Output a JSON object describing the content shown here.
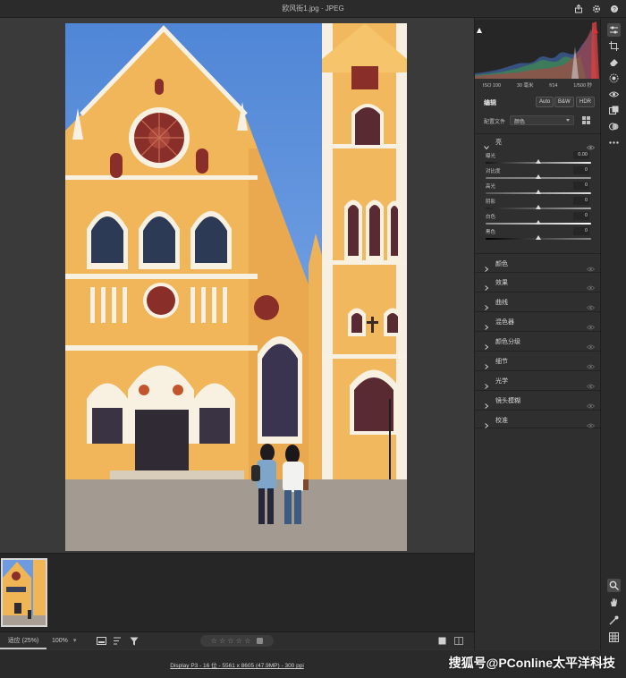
{
  "window": {
    "title": "欧风街1.jpg  ·  JPEG",
    "icons": [
      "share-icon",
      "settings-gear-icon",
      "help-icon"
    ]
  },
  "exif": [
    "ISO 100",
    "30 毫米",
    "f/14",
    "1/500 秒"
  ],
  "edit": {
    "title": "编辑",
    "auto_label": "Auto",
    "bw_label": "B&W",
    "hdr_label": "HDR",
    "profile_label": "配置文件",
    "profile_value": "颜色"
  },
  "light": {
    "label": "亮",
    "sliders": [
      {
        "label": "曝光",
        "value": "0.00"
      },
      {
        "label": "对比度",
        "value": "0"
      },
      {
        "label": "高光",
        "value": "0"
      },
      {
        "label": "阴影",
        "value": "0"
      },
      {
        "label": "白色",
        "value": "0"
      },
      {
        "label": "黑色",
        "value": "0"
      }
    ]
  },
  "sections": [
    "颜色",
    "效果",
    "曲线",
    "混色器",
    "颜色分级",
    "细节",
    "光学",
    "镜头模糊",
    "校准"
  ],
  "status": {
    "fit_label": "适应 (25%)",
    "zoom_label": "100%",
    "rating_stars": "☆ ☆ ☆ ☆ ☆"
  },
  "info": {
    "file_info": "Display P3 - 16 位 - 5561 x 8605 (47.9MP) - 300 ppi",
    "watermark": "搜狐号@PConline太平洋科技"
  },
  "colors": {
    "accent": "#d8d8d8",
    "panel_bg": "#2f2f2f",
    "work_bg": "#3a3a3a",
    "sky": "#5b8fd9",
    "facade": "#f0b555"
  }
}
